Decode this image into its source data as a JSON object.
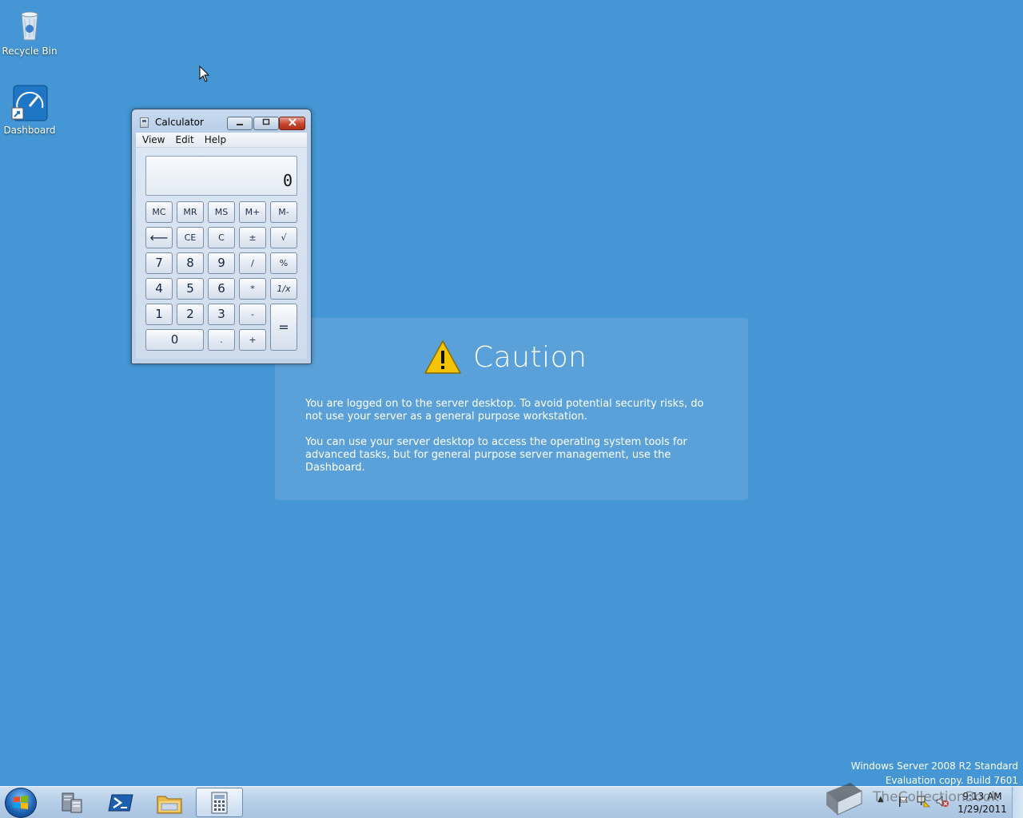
{
  "desktop": {
    "icons": [
      {
        "label": "Recycle Bin"
      },
      {
        "label": "Dashboard"
      }
    ]
  },
  "caution": {
    "title": "Caution",
    "paragraph1": "You are logged on to the server desktop. To avoid potential security risks, do not use your server as a general purpose workstation.",
    "paragraph2": "You can use your server desktop to access the operating system tools for advanced tasks, but for general purpose server management, use the Dashboard."
  },
  "calculator": {
    "title": "Calculator",
    "menu": [
      "View",
      "Edit",
      "Help"
    ],
    "display": "0",
    "keys": {
      "mc": "MC",
      "mr": "MR",
      "ms": "MS",
      "mplus": "M+",
      "mminus": "M-",
      "back": "⟵",
      "ce": "CE",
      "c": "C",
      "plusminus": "±",
      "sqrt": "√",
      "k7": "7",
      "k8": "8",
      "k9": "9",
      "div": "/",
      "pct": "%",
      "k4": "4",
      "k5": "5",
      "k6": "6",
      "mul": "*",
      "recip": "1/x",
      "k1": "1",
      "k2": "2",
      "k3": "3",
      "sub": "-",
      "eq": "=",
      "k0": "0",
      "dot": ".",
      "add": "+"
    }
  },
  "watermark": {
    "line1": "Windows Server 2008 R2 Standard",
    "line2": "Evaluation copy. Build 7601",
    "overlay": "TheCollectionBook"
  },
  "taskbar": {
    "clock_time": "9:13 AM",
    "clock_date": "1/29/2011",
    "colors": {
      "taskbar": "#b9d1ea",
      "desktop": "#4496d4"
    }
  }
}
